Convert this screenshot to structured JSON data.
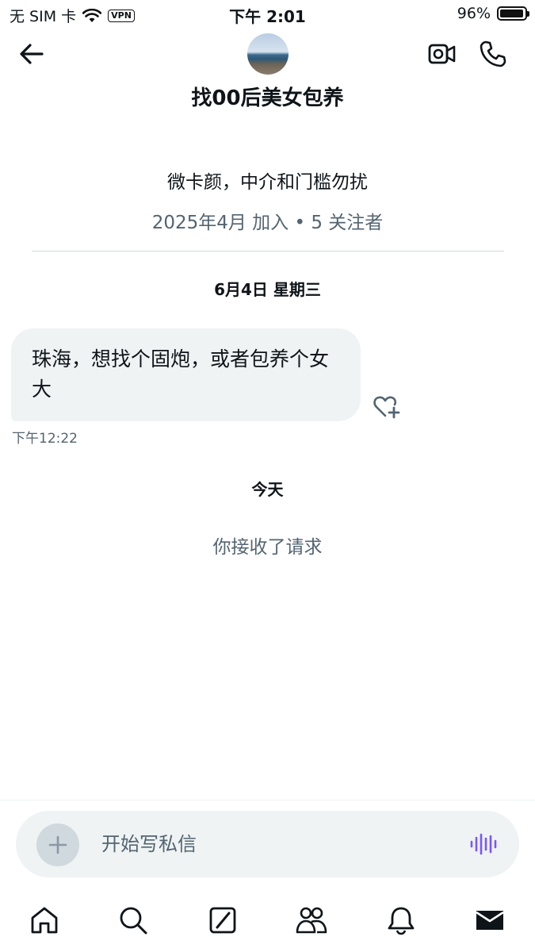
{
  "status_bar": {
    "carrier": "无 SIM 卡",
    "vpn": "VPN",
    "time": "下午 2:01",
    "battery": "96%",
    "battery_level": 0.96
  },
  "header": {
    "title": "找00后美女包养"
  },
  "profile": {
    "bio": "微卡颜，中介和门槛勿扰",
    "meta": "2025年4月 加入 • 5 关注者"
  },
  "conversation": {
    "date_1": "6月4日 星期三",
    "messages": [
      {
        "text": "珠海，想找个固炮，或者包养个女大",
        "time": "下午12:22"
      }
    ],
    "date_2": "今天",
    "system_note": "你接收了请求"
  },
  "composer": {
    "placeholder": "开始写私信"
  },
  "tabs": [
    "home-icon",
    "search-icon",
    "grok-icon",
    "communities-icon",
    "notifications-icon",
    "messages-icon"
  ],
  "colors": {
    "text": "#0f1419",
    "secondary": "#536471",
    "bubble": "#eff3f4",
    "accent_voice": "#7856ff"
  }
}
